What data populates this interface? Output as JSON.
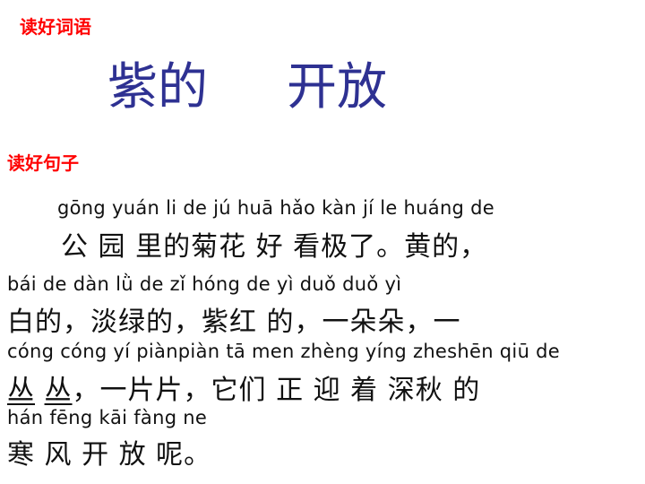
{
  "section1_label": "读好词语",
  "words": [
    "紫的",
    "开放"
  ],
  "section2_label": "读好句子",
  "lines": [
    {
      "pinyin": "gōng yuán li de jú huā hǎo kàn jí le  huáng de",
      "hanzi": "公 园 里的菊花 好 看极了。黄的，"
    },
    {
      "pinyin": "bái de  dàn lǜ de    zǐ hóng de   yì duǒ duǒ   yì",
      "hanzi": "白的，淡绿的，紫红 的，一朵朵，一"
    },
    {
      "pinyin": "cóng cóng  yí piànpiàn tā men zhèng yíng zheshēn qiū de",
      "hanzi_part1": "丛",
      "hanzi_gap": " ",
      "hanzi_part2": "丛",
      "hanzi_part3": "，一片片，它们 正 迎  着 深秋 的"
    },
    {
      "pinyin": "hán  fēng kāi fàng ne",
      "hanzi": "寒 风 开 放 呢。"
    }
  ]
}
